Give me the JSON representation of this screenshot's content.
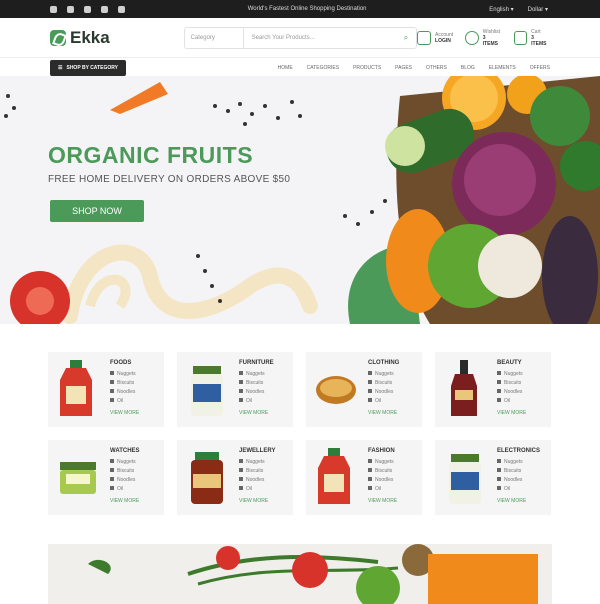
{
  "topbar": {
    "welcome": "World's Fastest Online Shopping Destination",
    "socials": [
      "facebook-icon",
      "twitter-icon",
      "youtube-icon",
      "instagram-icon",
      "linkedin-icon"
    ],
    "language": "English ▾",
    "currency": "Dollar ▾"
  },
  "header": {
    "logo_text": "Ekka",
    "search": {
      "category": "Category",
      "placeholder": "Search Your Products..."
    },
    "actions": [
      {
        "label": "Account",
        "value": "LOGIN"
      },
      {
        "label": "Wishlist",
        "value": "3 ITEMS"
      },
      {
        "label": "Cart",
        "value": "3 ITEMS"
      }
    ]
  },
  "nav": {
    "category_button": "SHOP BY CATEGORY",
    "menu": [
      "HOME",
      "CATEGORIES",
      "PRODUCTS",
      "PAGES",
      "OTHERS",
      "BLOG",
      "ELEMENTS",
      "OFFERS"
    ]
  },
  "hero": {
    "title": "ORGANIC FRUITS",
    "subtitle": "FREE HOME DELIVERY ON ORDERS ABOVE $50",
    "cta": "SHOP NOW"
  },
  "categories": [
    {
      "title": "FOODS",
      "items": [
        "Nuggets",
        "Biscuits",
        "Noodles",
        "Oil"
      ],
      "more": "VIEW MORE"
    },
    {
      "title": "FURNITURE",
      "items": [
        "Nuggets",
        "Biscuits",
        "Noodles",
        "Oil"
      ],
      "more": "VIEW MORE"
    },
    {
      "title": "CLOTHING",
      "items": [
        "Nuggets",
        "Biscuits",
        "Noodles",
        "Oil"
      ],
      "more": "VIEW MORE"
    },
    {
      "title": "BEAUTY",
      "items": [
        "Nuggets",
        "Biscuits",
        "Noodles",
        "Oil"
      ],
      "more": "VIEW MORE"
    },
    {
      "title": "WATCHES",
      "items": [
        "Nuggets",
        "Biscuits",
        "Noodles",
        "Oil"
      ],
      "more": "VIEW MORE"
    },
    {
      "title": "JEWELLERY",
      "items": [
        "Nuggets",
        "Biscuits",
        "Noodles",
        "Oil"
      ],
      "more": "VIEW MORE"
    },
    {
      "title": "FASHION",
      "items": [
        "Nuggets",
        "Biscuits",
        "Noodles",
        "Oil"
      ],
      "more": "VIEW MORE"
    },
    {
      "title": "ELECTRONICS",
      "items": [
        "Nuggets",
        "Biscuits",
        "Noodles",
        "Oil"
      ],
      "more": "VIEW MORE"
    }
  ],
  "colors": {
    "brand": "#4b9a5a",
    "dark": "#1e1e1e"
  }
}
